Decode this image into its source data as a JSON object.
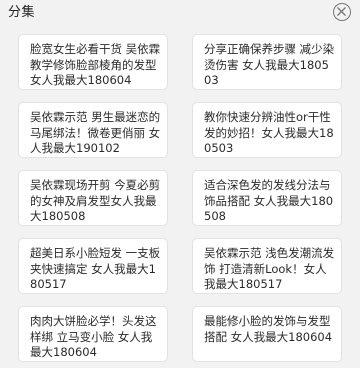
{
  "header": {
    "title": "分集",
    "close_icon": "close-circle-icon"
  },
  "episodes": [
    {
      "title": "脸宽女生必看干货 吴依霖教学修饰脸部棱角的发型 女人我最大180604"
    },
    {
      "title": "分享正确保养步骤 减少染烫伤害 女人我最大180503"
    },
    {
      "title": "吴依霖示范 男生最迷恋的马尾绑法！微卷更俏丽 女人我最大190102"
    },
    {
      "title": "教你快速分辨油性or干性发的妙招！女人我最大180503"
    },
    {
      "title": "吴依霖现场开剪 今夏必剪的女神及肩发型女人我最大180508"
    },
    {
      "title": "适合深色发的发线分法与饰品搭配 女人我最大180508"
    },
    {
      "title": "超美日系小脸短发 一支板夹快速搞定 女人我最大180517"
    },
    {
      "title": "吴依霖示范 浅色发潮流发饰 打造清新Look！女人我最大180517"
    },
    {
      "title": "肉肉大饼脸必学！头发这样绑 立马变小脸 女人我最大180604"
    },
    {
      "title": "最能修小脸的发饰与发型搭配 女人我最大180604"
    }
  ]
}
